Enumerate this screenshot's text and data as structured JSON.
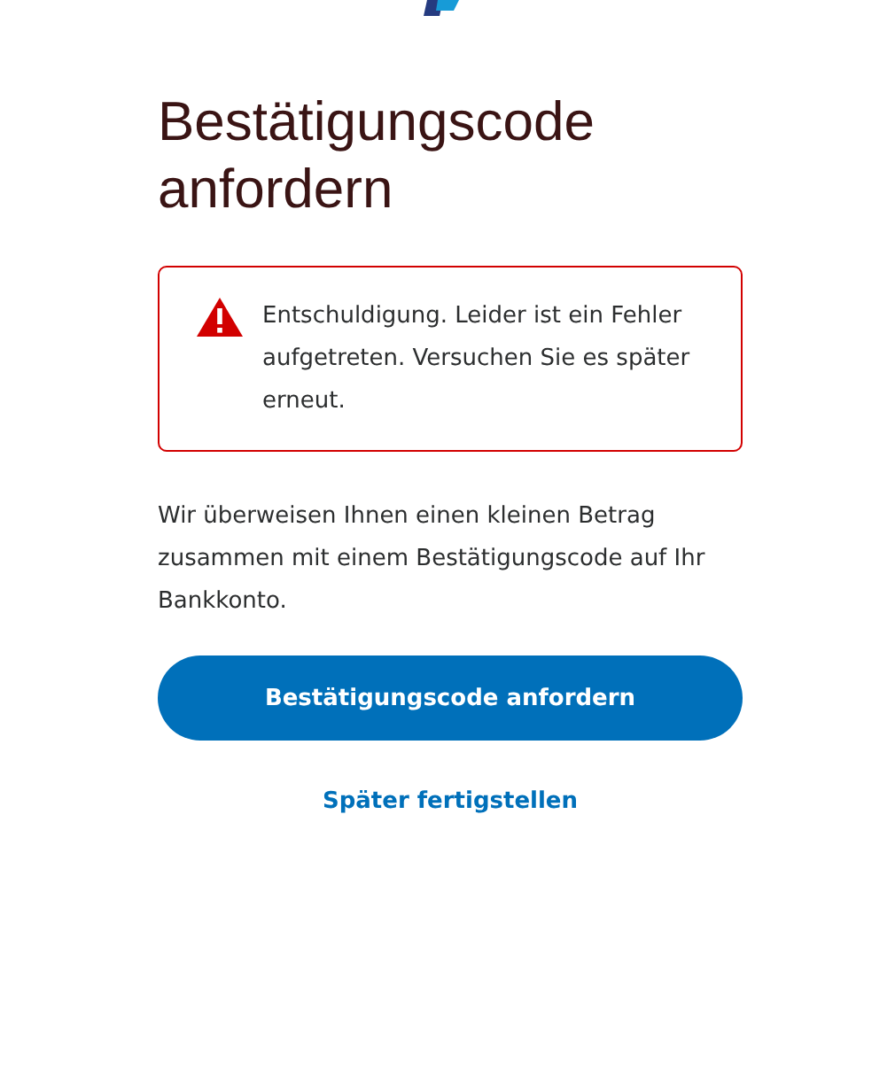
{
  "title": "Bestätigungscode anfordern",
  "alert": {
    "kind": "error",
    "message": "Entschuldigung. Leider ist ein Fehler aufgetreten. Versuchen Sie es später erneut."
  },
  "description": "Wir überweisen Ihnen einen kleinen Betrag zusammen mit einem Bestätigungscode auf Ihr Bankkonto.",
  "primary_button": "Bestätigungscode anfordern",
  "secondary_link": "Später fertigstellen"
}
